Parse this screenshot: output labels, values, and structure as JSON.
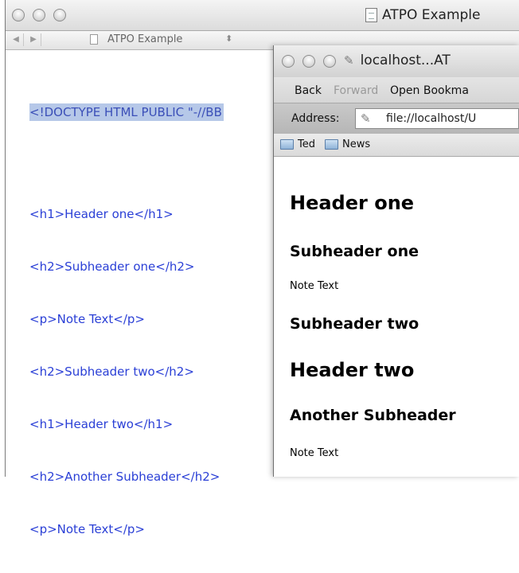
{
  "editor": {
    "title": "ATPO Example",
    "nav_doc_name": "ATPO Example",
    "code_lines": {
      "doctype": "<!DOCTYPE HTML PUBLIC \"-//BB",
      "l1": "<h1>Header one</h1>",
      "l2": "<h2>Subheader one</h2>",
      "l3": "<p>Note Text</p>",
      "l4": "<h2>Subheader two</h2>",
      "l5": "<h1>Header two</h1>",
      "l6": "<h2>Another Subheader</h2>",
      "l7": "<p>Note Text</p>"
    }
  },
  "browser": {
    "title": "localhost...AT",
    "toolbar": {
      "back": "Back",
      "forward": "Forward",
      "open_bookmarks": "Open Bookma"
    },
    "address_label": "Address:",
    "address_value": "file://localhost/U",
    "bookmarks": [
      "Ted",
      "News"
    ],
    "content": {
      "h1_a": "Header one",
      "h2_a": "Subheader one",
      "p_a": "Note Text",
      "h2_b": "Subheader two",
      "h1_b": "Header two",
      "h2_c": "Another Subheader",
      "p_b": "Note Text"
    }
  },
  "icons": {
    "window_buttons": [
      "close-button",
      "minimize-button",
      "zoom-button"
    ],
    "doc": "document-icon",
    "link": "link-icon",
    "folder": "folder-icon"
  }
}
